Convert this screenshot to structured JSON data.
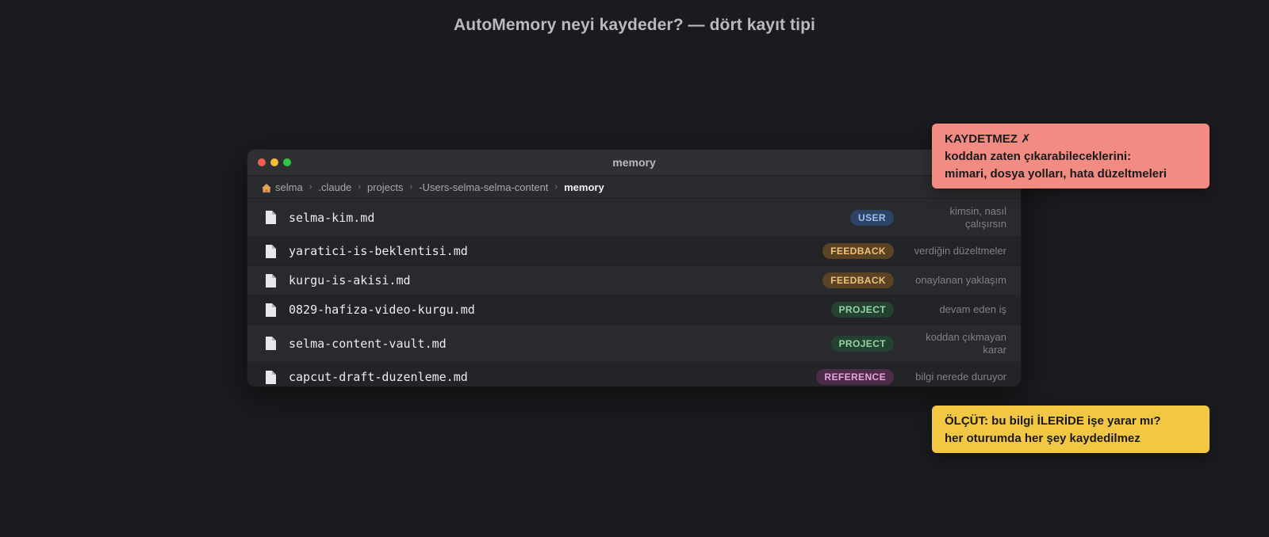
{
  "page": {
    "title": "AutoMemory neyi kaydeder? — dört kayıt tipi"
  },
  "window": {
    "title": "memory",
    "breadcrumb": [
      {
        "label": "selma",
        "icon": "home-icon"
      },
      {
        "label": ".claude"
      },
      {
        "label": "projects"
      },
      {
        "label": "-Users-selma-selma-content"
      },
      {
        "label": "memory",
        "current": true
      }
    ],
    "breadcrumb_separator": "›",
    "files": [
      {
        "name": "selma-kim.md",
        "type": "USER",
        "desc_lines": [
          "kimsin, nasıl",
          "çalışırsın"
        ]
      },
      {
        "name": "yaratici-is-beklentisi.md",
        "type": "FEEDBACK",
        "desc_lines": [
          "verdiğin düzeltmeler"
        ]
      },
      {
        "name": "kurgu-is-akisi.md",
        "type": "FEEDBACK",
        "desc_lines": [
          "onaylanan yaklaşım"
        ]
      },
      {
        "name": "0829-hafiza-video-kurgu.md",
        "type": "PROJECT",
        "desc_lines": [
          "devam eden iş"
        ]
      },
      {
        "name": "selma-content-vault.md",
        "type": "PROJECT",
        "desc_lines": [
          "koddan çıkmayan",
          "karar"
        ]
      },
      {
        "name": "capcut-draft-duzenleme.md",
        "type": "REFERENCE",
        "desc_lines": [
          "bilgi nerede duruyor"
        ]
      }
    ]
  },
  "callouts": {
    "not_saved": {
      "lines": [
        "KAYDETMEZ ✗",
        "koddan zaten çıkarabileceklerini:",
        "mimari, dosya yolları, hata düzeltmeleri"
      ],
      "color": "#f28b82"
    },
    "criterion": {
      "lines": [
        "ÖLÇÜT: bu bilgi İLERİDE işe yarar mı?",
        "her oturumda her şey kaydedilmez"
      ],
      "color": "#f2c744"
    }
  },
  "colors": {
    "background": "#1a1b1e",
    "badge_user": "#9cc0f5",
    "badge_feedback": "#f0c27a",
    "badge_project": "#8fd7a3",
    "badge_reference": "#e7a4dc"
  }
}
